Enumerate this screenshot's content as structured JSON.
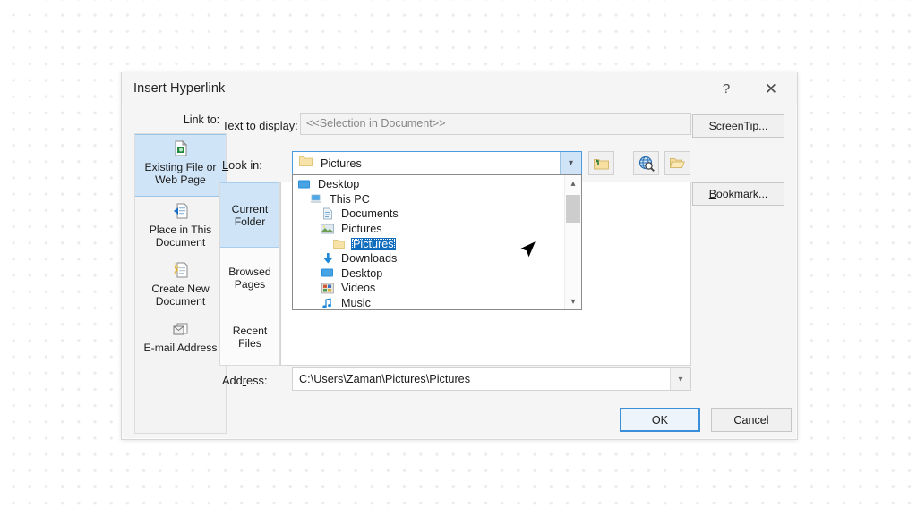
{
  "dialog": {
    "title": "Insert Hyperlink",
    "help_label": "?",
    "close_label": "✕"
  },
  "link_to": {
    "label": "Link to:",
    "items": [
      {
        "label": "Existing File or\nWeb Page",
        "icon": "existing-file-web-page-icon",
        "selected": true
      },
      {
        "label": "Place in This\nDocument",
        "icon": "place-in-document-icon",
        "selected": false
      },
      {
        "label": "Create New\nDocument",
        "icon": "create-new-document-icon",
        "selected": false
      },
      {
        "label": "E-mail Address",
        "icon": "email-address-icon",
        "selected": false
      }
    ]
  },
  "text_to_display": {
    "label": "Text to display:",
    "value": "<<Selection in Document>>"
  },
  "look_in": {
    "label": "Look in:",
    "value": "Pictures",
    "folder_icon": "folder-icon",
    "dropdown_arrow": "chevron-down-icon",
    "tools": [
      {
        "name": "up-one-folder-button",
        "title": "Up One Folder"
      },
      {
        "name": "browse-the-web-button",
        "title": "Browse the Web"
      },
      {
        "name": "browse-for-file-button",
        "title": "Browse for File"
      }
    ]
  },
  "tabs": [
    {
      "label": "Current\nFolder",
      "selected": true
    },
    {
      "label": "Browsed\nPages",
      "selected": false
    },
    {
      "label": "Recent Files",
      "selected": false
    }
  ],
  "tree": {
    "items": [
      {
        "label": "Desktop",
        "indent": 0,
        "icon": "desktop-icon",
        "selected": false
      },
      {
        "label": "This PC",
        "indent": 1,
        "icon": "this-pc-icon",
        "selected": false
      },
      {
        "label": "Documents",
        "indent": 2,
        "icon": "documents-icon",
        "selected": false
      },
      {
        "label": "Pictures",
        "indent": 2,
        "icon": "pictures-icon",
        "selected": false
      },
      {
        "label": "Pictures",
        "indent": 3,
        "icon": "folder-icon",
        "selected": true
      },
      {
        "label": "Downloads",
        "indent": 2,
        "icon": "downloads-icon",
        "selected": false
      },
      {
        "label": "Desktop",
        "indent": 2,
        "icon": "desktop-icon",
        "selected": false
      },
      {
        "label": "Videos",
        "indent": 2,
        "icon": "videos-icon",
        "selected": false
      },
      {
        "label": "Music",
        "indent": 2,
        "icon": "music-icon",
        "selected": false
      }
    ],
    "scroll_up": "chevron-up-icon",
    "scroll_down": "chevron-down-icon"
  },
  "address": {
    "label": "Address:",
    "value": "C:\\Users\\Zaman\\Pictures\\Pictures",
    "dropdown_arrow": "chevron-down-icon"
  },
  "side_buttons": {
    "screentip": "ScreenTip...",
    "bookmark": "Bookmark..."
  },
  "footer": {
    "ok": "OK",
    "cancel": "Cancel"
  },
  "colors": {
    "selection_blue": "#0f6cbd",
    "highlight_fill": "#cfe4f7",
    "focus_border": "#3b8fd8",
    "dialog_bg": "#f5f5f5"
  }
}
